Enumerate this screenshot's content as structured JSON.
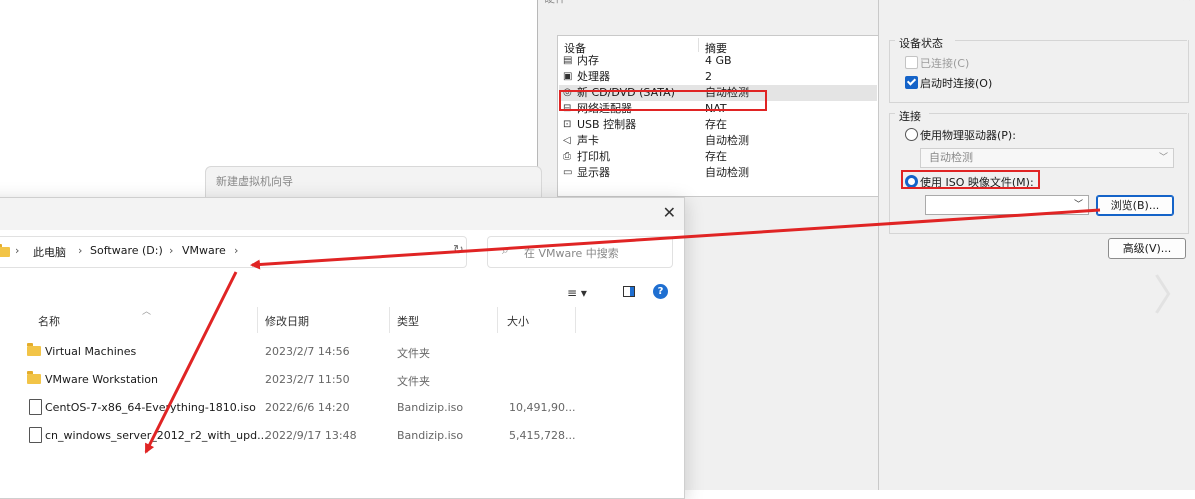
{
  "hw": {
    "title": "硬件",
    "close_glyph": "✕",
    "dev_col_header": "设备",
    "sum_col_header": "摘要",
    "devices": [
      {
        "name": "内存",
        "summary": "4 GB",
        "icon": "memory-icon",
        "glyph": "▤"
      },
      {
        "name": "处理器",
        "summary": "2",
        "icon": "cpu-icon",
        "glyph": "▣"
      },
      {
        "name": "新 CD/DVD (SATA)",
        "summary": "自动检测",
        "icon": "cd-dvd-icon",
        "glyph": "◎",
        "selected": true
      },
      {
        "name": "网络适配器",
        "summary": "NAT",
        "icon": "network-icon",
        "glyph": "⊟"
      },
      {
        "name": "USB 控制器",
        "summary": "存在",
        "icon": "usb-icon",
        "glyph": "⊡"
      },
      {
        "name": "声卡",
        "summary": "自动检测",
        "icon": "sound-icon",
        "glyph": "◁"
      },
      {
        "name": "打印机",
        "summary": "存在",
        "icon": "printer-icon",
        "glyph": "⎙"
      },
      {
        "name": "显示器",
        "summary": "自动检测",
        "icon": "display-icon",
        "glyph": "▭"
      }
    ],
    "device_status": {
      "title": "设备状态",
      "connected": "已连接(C)",
      "connect_on_power": "启动时连接(O)"
    },
    "connection": {
      "title": "连接",
      "physical_drive": "使用物理驱动器(P):",
      "physical_value": "自动检测",
      "iso_image": "使用 ISO 映像文件(M):",
      "iso_value": "",
      "browse": "浏览(B)..."
    },
    "advanced": "高级(V)..."
  },
  "wizard": {
    "title": "新建虚拟机向导"
  },
  "explorer": {
    "close_glyph": "✕",
    "breadcrumb": [
      "此电脑",
      "Software (D:)",
      "VMware"
    ],
    "sep": "›",
    "search_placeholder": "在 VMware 中搜索",
    "columns": {
      "name": "名称",
      "date": "修改日期",
      "type": "类型",
      "size": "大小"
    },
    "view_menu": "≡ ▾",
    "help": "?",
    "files": [
      {
        "name": "Virtual Machines",
        "date": "2023/2/7 14:56",
        "type": "文件夹",
        "size": "",
        "kind": "folder"
      },
      {
        "name": "VMware Workstation",
        "date": "2023/2/7 11:50",
        "type": "文件夹",
        "size": "",
        "kind": "folder"
      },
      {
        "name": "CentOS-7-x86_64-Everything-1810.iso",
        "date": "2022/6/6 14:20",
        "type": "Bandizip.iso",
        "size": "10,491,90...",
        "kind": "file"
      },
      {
        "name": "cn_windows_server_2012_r2_with_upd...",
        "date": "2022/9/17 13:48",
        "type": "Bandizip.iso",
        "size": "5,415,728...",
        "kind": "file"
      }
    ]
  },
  "colors": {
    "accent": "#1463c8",
    "highlight": "#e02424",
    "folder": "#f2c447"
  }
}
